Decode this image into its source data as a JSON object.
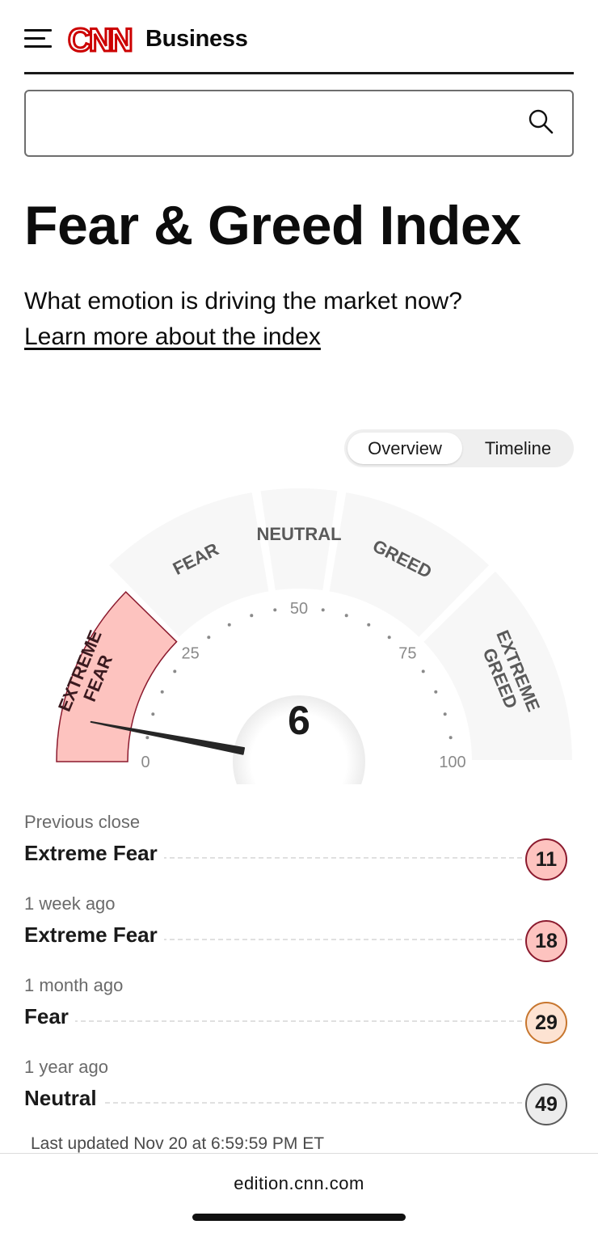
{
  "header": {
    "menu_icon": "hamburger-menu-icon",
    "logo_text": "CNN",
    "brand_word": "Business"
  },
  "search": {
    "value": "",
    "placeholder": "",
    "icon": "search-icon"
  },
  "main": {
    "title": "Fear & Greed Index",
    "subtitle": "What emotion is driving the market now?",
    "learn_link": "Learn more about the index"
  },
  "tabs": [
    {
      "label": "Overview",
      "active": true
    },
    {
      "label": "Timeline",
      "active": false
    }
  ],
  "gauge": {
    "score": "6",
    "value": 6,
    "current_zone": "EXTREME FEAR",
    "ticks": [
      "0",
      "25",
      "50",
      "75",
      "100"
    ],
    "zones": [
      {
        "label": "EXTREME FEAR",
        "from": 0,
        "to": 25
      },
      {
        "label": "FEAR",
        "from": 25,
        "to": 45
      },
      {
        "label": "NEUTRAL",
        "from": 45,
        "to": 55
      },
      {
        "label": "GREED",
        "from": 55,
        "to": 75
      },
      {
        "label": "EXTREME GREED",
        "from": 75,
        "to": 100
      }
    ],
    "colors": {
      "active_fill": "#fdc3bf",
      "active_stroke": "#8b1a2e",
      "inactive_fill": "#f7f7f7",
      "needle": "#262626"
    }
  },
  "history": [
    {
      "when": "Previous close",
      "rating": "Extreme Fear",
      "score": "11",
      "fill": "#fdc3bf",
      "stroke": "#8b1a2e"
    },
    {
      "when": "1 week ago",
      "rating": "Extreme Fear",
      "score": "18",
      "fill": "#fdc3bf",
      "stroke": "#8b1a2e"
    },
    {
      "when": "1 month ago",
      "rating": "Fear",
      "score": "29",
      "fill": "#fde3d2",
      "stroke": "#c7762e"
    },
    {
      "when": "1 year ago",
      "rating": "Neutral",
      "score": "49",
      "fill": "#ececec",
      "stroke": "#5a5a5a"
    }
  ],
  "updated": "Last updated Nov 20 at 6:59:59 PM ET",
  "browser": {
    "url": "edition.cnn.com"
  }
}
